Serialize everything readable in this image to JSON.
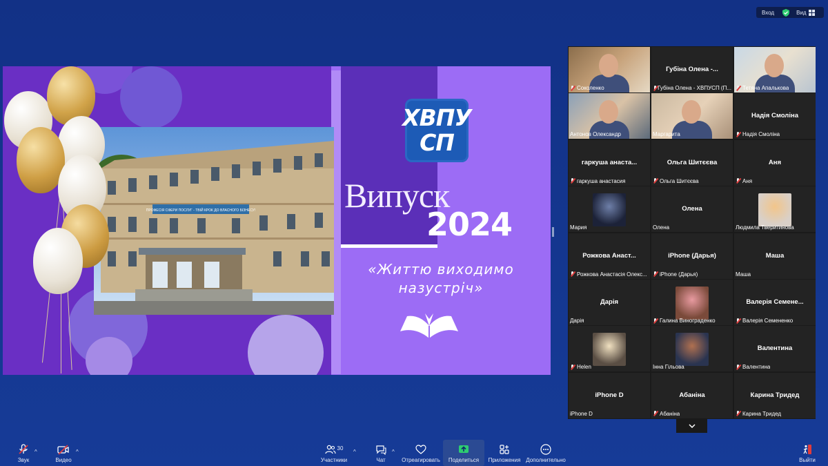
{
  "topbar": {
    "login": "Вход",
    "view": "Вид"
  },
  "slide": {
    "logo_line1": "ХВПУ",
    "logo_line2": "СП",
    "heading": "Випуск",
    "year": "2024",
    "motto_line1": "«Життю виходимо",
    "motto_line2": "назустріч»",
    "sign_text": "ПРОФЕСІЯ СФЕРИ ПОСЛУГ - ТВІЙ КРОК ДО ВЛАСНОГО БІЗНЕСУ!"
  },
  "gallery": {
    "tiles": [
      {
        "name": "",
        "label": "Соколенко",
        "muted": true,
        "video": true
      },
      {
        "name": "Губіна Олена -...",
        "label": "Губіна Олена - ХВПУСП (П...",
        "muted": true,
        "video": false
      },
      {
        "name": "",
        "label": "Тетяна Апалькова",
        "muted": true,
        "video": true
      },
      {
        "name": "",
        "label": "Антонов Олександр",
        "muted": false,
        "video": true
      },
      {
        "name": "",
        "label": "Маргарита",
        "muted": false,
        "video": true,
        "active": true
      },
      {
        "name": "Надія Смоліна",
        "label": "Надія Смоліна",
        "muted": true,
        "video": false
      },
      {
        "name": "гаркуша анаста...",
        "label": "гаркуша анастасия",
        "muted": true,
        "video": false
      },
      {
        "name": "Ольга Шитєєва",
        "label": "Ольга Шитєєва",
        "muted": true,
        "video": false
      },
      {
        "name": "Аня",
        "label": "Аня",
        "muted": true,
        "video": false
      },
      {
        "name": "",
        "label": "Мария",
        "muted": false,
        "video": false,
        "avatar": true
      },
      {
        "name": "Олена",
        "label": "Олена",
        "muted": false,
        "video": false
      },
      {
        "name": "",
        "label": "Людмила Тверитинова",
        "muted": false,
        "video": false,
        "avatar": true
      },
      {
        "name": "Рожкова Анаст...",
        "label": "Рожкова Анастасія Олекс...",
        "muted": true,
        "video": false
      },
      {
        "name": "iPhone (Дарья)",
        "label": "iPhone (Дарья)",
        "muted": true,
        "video": false
      },
      {
        "name": "Маша",
        "label": "Маша",
        "muted": false,
        "video": false
      },
      {
        "name": "Дарія",
        "label": "Дарія",
        "muted": false,
        "video": false
      },
      {
        "name": "",
        "label": "Галина Винограденко",
        "muted": true,
        "video": false,
        "avatar": true
      },
      {
        "name": "Валерія Семене...",
        "label": "Валерія Семененко",
        "muted": true,
        "video": false
      },
      {
        "name": "",
        "label": "Helen",
        "muted": true,
        "video": false,
        "avatar": true
      },
      {
        "name": "",
        "label": "Інна Гільова",
        "muted": false,
        "video": false,
        "avatar": true
      },
      {
        "name": "Валентина",
        "label": "Валентина",
        "muted": true,
        "video": false
      },
      {
        "name": "iPhone D",
        "label": "iPhone D",
        "muted": false,
        "video": false
      },
      {
        "name": "Абаніна",
        "label": "Абаніна",
        "muted": true,
        "video": false
      },
      {
        "name": "Карина Тридед",
        "label": "Карина Тридед",
        "muted": true,
        "video": false
      }
    ]
  },
  "toolbar": {
    "audio": "Звук",
    "video": "Видео",
    "participants": "Участники",
    "participants_count": "30",
    "chat": "Чат",
    "react": "Отреагировать",
    "share": "Поделиться",
    "apps": "Приложения",
    "more": "Дополнительно",
    "leave": "Выйти"
  },
  "colors": {
    "accent_green": "#2ecc71",
    "muted_red": "#e03c3c",
    "background": "#12338c"
  }
}
